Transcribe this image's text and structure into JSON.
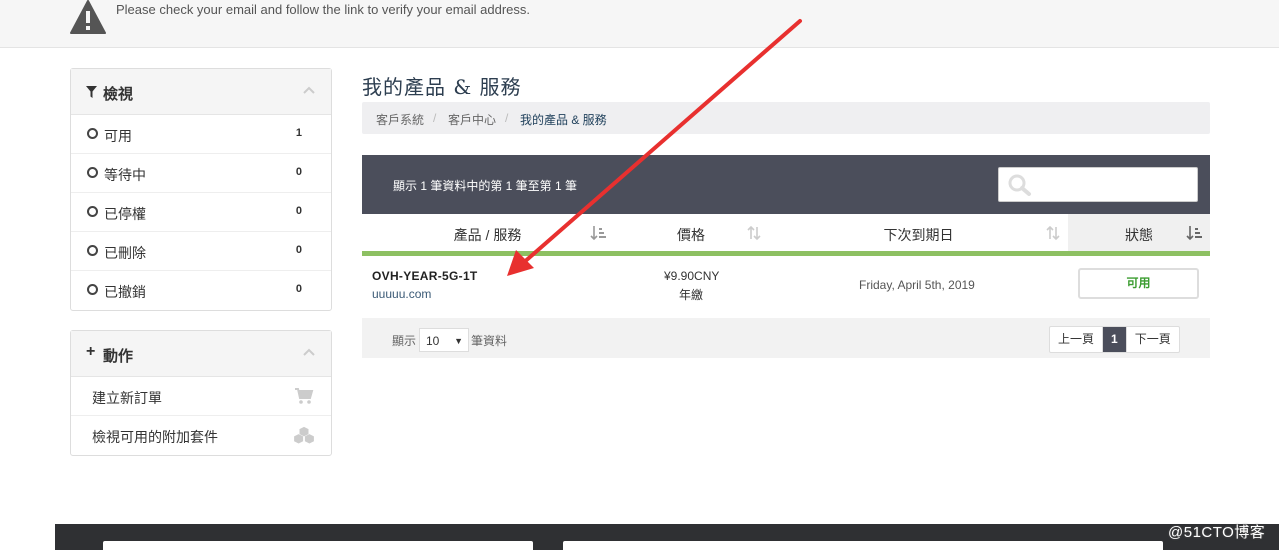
{
  "notice": {
    "text": "Please check your email and follow the link to verify your email address."
  },
  "sidebar": {
    "view": {
      "title": "檢視",
      "items": [
        {
          "label": "可用",
          "count": "1"
        },
        {
          "label": "等待中",
          "count": "0"
        },
        {
          "label": "已停權",
          "count": "0"
        },
        {
          "label": "已刪除",
          "count": "0"
        },
        {
          "label": "已撤銷",
          "count": "0"
        }
      ]
    },
    "actions": {
      "title": "動作",
      "items": [
        {
          "label": "建立新訂單",
          "icon": "cart-icon"
        },
        {
          "label": "檢視可用的附加套件",
          "icon": "cubes-icon"
        }
      ]
    }
  },
  "main": {
    "title": "我的產品 & 服務",
    "breadcrumb": [
      "客戶系統",
      "客戶中心",
      "我的產品 & 服務"
    ],
    "table_info": "顯示 1 筆資料中的第 1 筆至第 1 筆",
    "search": {
      "placeholder": ""
    },
    "columns": [
      "產品 / 服務",
      "價格",
      "下次到期日",
      "狀態"
    ],
    "row": {
      "product": "OVH-YEAR-5G-1T",
      "domain": "uuuuu.com",
      "price": "¥9.90CNY",
      "cycle": "年繳",
      "due": "Friday, April 5th, 2019",
      "status": "可用"
    },
    "footer": {
      "show": "顯示",
      "per_page": "10",
      "records": "筆資料",
      "prev": "上一頁",
      "page": "1",
      "next": "下一頁"
    }
  },
  "colors": {
    "accent": "#8dc062",
    "header_bg": "#4b4e5b",
    "status_green": "#3c9d31",
    "arrow": "#e8302f"
  },
  "watermark": "@51CTO博客"
}
